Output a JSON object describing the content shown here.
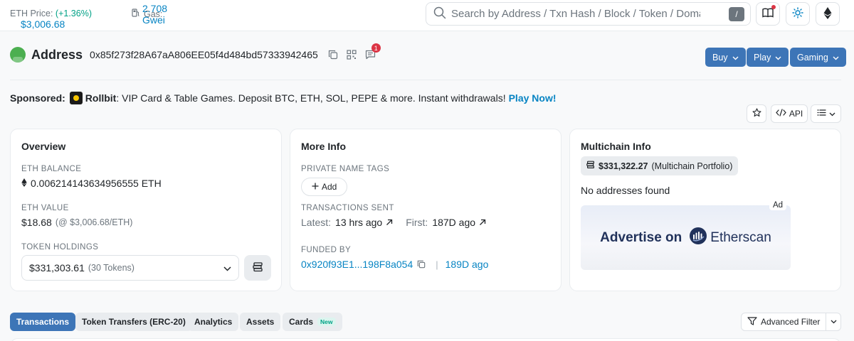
{
  "topbar": {
    "eth_price_label": "ETH Price:",
    "eth_price_value": "$3,006.68",
    "eth_price_change": "(+1.36%)",
    "gas_label": "Gas:",
    "gas_value": "2.708 Gwei",
    "search_placeholder": "Search by Address / Txn Hash / Block / Token / Domain Name",
    "search_shortcut": "/"
  },
  "address_header": {
    "title": "Address",
    "hash": "0x85f273f28A67aA806EE05f4d484bd57333942465",
    "notification_count": "1",
    "buttons": [
      {
        "label": "Buy"
      },
      {
        "label": "Play"
      },
      {
        "label": "Gaming"
      }
    ]
  },
  "sponsored": {
    "label": "Sponsored:",
    "brand": "Rollbit",
    "text": ": VIP Card & Table Games. Deposit BTC, ETH, SOL, PEPE & more. Instant withdrawals!",
    "cta": "Play Now!"
  },
  "actions": {
    "api_label": "API"
  },
  "overview": {
    "title": "Overview",
    "eth_balance_label": "ETH BALANCE",
    "eth_balance": "0.006214143634956555 ETH",
    "eth_value_label": "ETH VALUE",
    "eth_value": "$18.68",
    "eth_value_rate": "(@ $3,006.68/ETH)",
    "token_holdings_label": "TOKEN HOLDINGS",
    "token_holdings_value": "$331,303.61",
    "token_holdings_count": "(30 Tokens)"
  },
  "more_info": {
    "title": "More Info",
    "private_tags_label": "PRIVATE NAME TAGS",
    "add_label": "Add",
    "tx_sent_label": "TRANSACTIONS SENT",
    "latest_label": "Latest:",
    "latest_value": "13 hrs ago",
    "first_label": "First:",
    "first_value": "187D ago",
    "funded_by_label": "FUNDED BY",
    "funded_by_address": "0x920f93E1...198F8a054",
    "funded_by_age": "189D ago",
    "separator": "|"
  },
  "multichain": {
    "title": "Multichain Info",
    "portfolio_value": "$331,322.27",
    "portfolio_label": "(Multichain Portfolio)",
    "no_addresses": "No addresses found",
    "ad_tag": "Ad",
    "ad_text": "Advertise on",
    "ad_brand": "Etherscan"
  },
  "tabs": [
    {
      "label": "Transactions",
      "active": true
    },
    {
      "label": "Token Transfers (ERC-20)"
    },
    {
      "label": "Analytics"
    },
    {
      "label": "Assets"
    },
    {
      "label": "Cards",
      "badge": "New"
    }
  ],
  "advanced_filter_label": "Advanced Filter",
  "colors": {
    "accent": "#3d75b7",
    "link": "#0784c3",
    "positive": "#00a186",
    "alert": "#dc3545"
  }
}
